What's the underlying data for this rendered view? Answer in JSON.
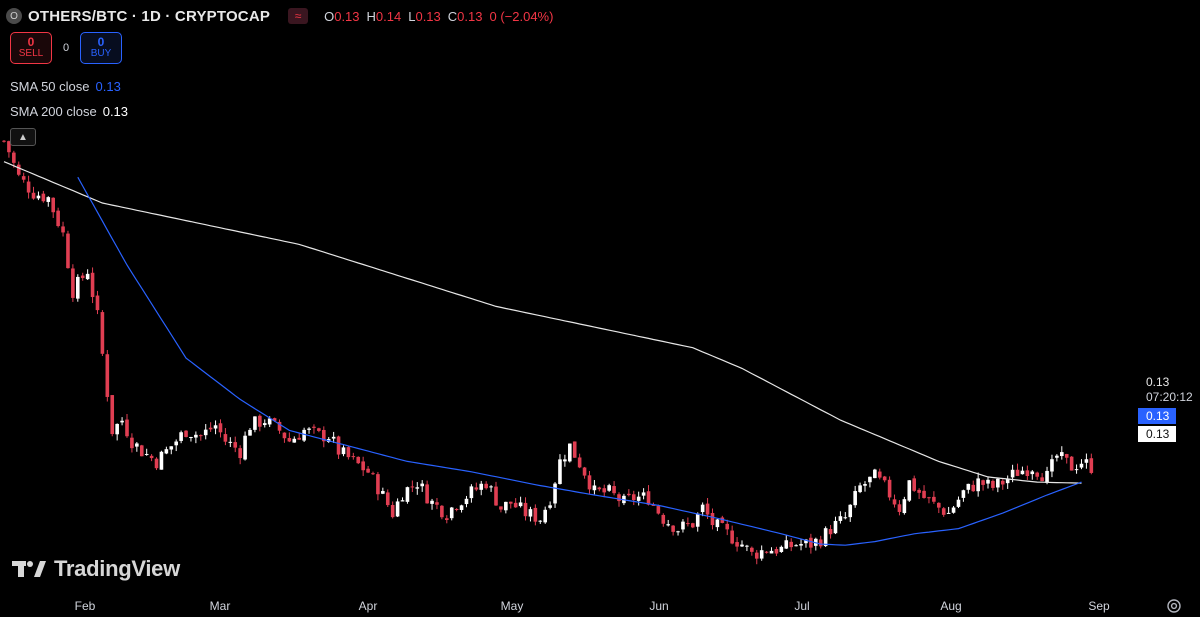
{
  "header": {
    "symbol_badge": "O",
    "title": "OTHERS/BTC · 1D · CRYPTOCAP",
    "indicator_icon": "≈",
    "ohlc": {
      "o_label": "O",
      "o": "0.13",
      "h_label": "H",
      "h": "0.14",
      "l_label": "L",
      "l": "0.13",
      "c_label": "C",
      "c": "0.13",
      "change": "0 (−2.04%)"
    }
  },
  "trade": {
    "sell_count": "0",
    "sell_label": "SELL",
    "spread": "0",
    "buy_count": "0",
    "buy_label": "BUY"
  },
  "indicators": {
    "sma50": {
      "label": "SMA 50 close",
      "value": "0.13"
    },
    "sma200": {
      "label": "SMA 200 close",
      "value": "0.13"
    }
  },
  "collapse_icon": "chevron-up-icon",
  "price_scale": {
    "last_price": "0.13",
    "countdown": "07:20:12",
    "sma50_value": "0.13",
    "sma200_value": "0.13"
  },
  "logo": {
    "text": "TradingView"
  },
  "colors": {
    "background": "#000000",
    "up_candle": "#ffffff",
    "down_candle": "#e03e52",
    "sma50": "#2962ff",
    "sma200": "#e6e6e6",
    "text": "#d1d4dc"
  },
  "chart_data": {
    "type": "candlestick",
    "title": "OTHERS/BTC · 1D · CRYPTOCAP",
    "x_ticks": [
      "Feb",
      "Mar",
      "Apr",
      "May",
      "Jun",
      "Jul",
      "Aug",
      "Sep"
    ],
    "y_range_approx": [
      0.1268,
      0.21
    ],
    "series": [
      {
        "name": "OTHERS/BTC daily close (approx.)",
        "type": "close",
        "points": [
          [
            0,
            0.204
          ],
          [
            1,
            0.202
          ],
          [
            3,
            0.197
          ],
          [
            6,
            0.194
          ],
          [
            9,
            0.193
          ],
          [
            12,
            0.186
          ],
          [
            14,
            0.175
          ],
          [
            17,
            0.179
          ],
          [
            19,
            0.17
          ],
          [
            22,
            0.148
          ],
          [
            24,
            0.15
          ],
          [
            26,
            0.146
          ],
          [
            28,
            0.144
          ],
          [
            31,
            0.142
          ],
          [
            34,
            0.145
          ],
          [
            37,
            0.148
          ],
          [
            40,
            0.147
          ],
          [
            43,
            0.149
          ],
          [
            45,
            0.146
          ],
          [
            48,
            0.144
          ],
          [
            50,
            0.149
          ],
          [
            53,
            0.15
          ],
          [
            56,
            0.148
          ],
          [
            58,
            0.146
          ],
          [
            61,
            0.148
          ],
          [
            64,
            0.147
          ],
          [
            66,
            0.147
          ],
          [
            68,
            0.144
          ],
          [
            71,
            0.142
          ],
          [
            74,
            0.14
          ],
          [
            76,
            0.137
          ],
          [
            79,
            0.132
          ],
          [
            81,
            0.136
          ],
          [
            84,
            0.138
          ],
          [
            87,
            0.134
          ],
          [
            90,
            0.132
          ],
          [
            92,
            0.134
          ],
          [
            95,
            0.136
          ],
          [
            98,
            0.138
          ],
          [
            101,
            0.133
          ],
          [
            103,
            0.134
          ],
          [
            106,
            0.132
          ],
          [
            109,
            0.131
          ],
          [
            111,
            0.135
          ],
          [
            113,
            0.142
          ],
          [
            115,
            0.145
          ],
          [
            118,
            0.14
          ],
          [
            120,
            0.136
          ],
          [
            123,
            0.136
          ],
          [
            126,
            0.134
          ],
          [
            128,
            0.135
          ],
          [
            131,
            0.135
          ],
          [
            134,
            0.131
          ],
          [
            137,
            0.129
          ],
          [
            140,
            0.13
          ],
          [
            142,
            0.133
          ],
          [
            144,
            0.13
          ],
          [
            147,
            0.128
          ],
          [
            150,
            0.126
          ],
          [
            152,
            0.124
          ],
          [
            155,
            0.125
          ],
          [
            158,
            0.125
          ],
          [
            161,
            0.126
          ],
          [
            164,
            0.126
          ],
          [
            166,
            0.127
          ],
          [
            168,
            0.129
          ],
          [
            171,
            0.131
          ],
          [
            174,
            0.137
          ],
          [
            177,
            0.139
          ],
          [
            179,
            0.137
          ],
          [
            182,
            0.133
          ],
          [
            184,
            0.138
          ],
          [
            187,
            0.135
          ],
          [
            190,
            0.133
          ],
          [
            192,
            0.132
          ],
          [
            195,
            0.136
          ],
          [
            198,
            0.138
          ],
          [
            201,
            0.137
          ],
          [
            203,
            0.138
          ],
          [
            206,
            0.14
          ],
          [
            209,
            0.141
          ],
          [
            212,
            0.139
          ],
          [
            214,
            0.143
          ],
          [
            217,
            0.141
          ],
          [
            219,
            0.142
          ],
          [
            221,
            0.141
          ]
        ]
      },
      {
        "name": "SMA 50 close",
        "type": "line",
        "points": [
          [
            15,
            0.197
          ],
          [
            25,
            0.18
          ],
          [
            37,
            0.162
          ],
          [
            48,
            0.154
          ],
          [
            58,
            0.148
          ],
          [
            70,
            0.145
          ],
          [
            82,
            0.142
          ],
          [
            95,
            0.14
          ],
          [
            108,
            0.1375
          ],
          [
            120,
            0.1355
          ],
          [
            133,
            0.1335
          ],
          [
            145,
            0.131
          ],
          [
            158,
            0.128
          ],
          [
            166,
            0.126
          ],
          [
            171,
            0.1258
          ],
          [
            177,
            0.1265
          ],
          [
            185,
            0.128
          ],
          [
            194,
            0.129
          ],
          [
            203,
            0.132
          ],
          [
            212,
            0.1355
          ],
          [
            219,
            0.138
          ]
        ]
      },
      {
        "name": "SMA 200 close",
        "type": "line",
        "points": [
          [
            0,
            0.2
          ],
          [
            20,
            0.192
          ],
          [
            40,
            0.188
          ],
          [
            60,
            0.184
          ],
          [
            80,
            0.178
          ],
          [
            100,
            0.172
          ],
          [
            120,
            0.168
          ],
          [
            140,
            0.164
          ],
          [
            150,
            0.16
          ],
          [
            160,
            0.155
          ],
          [
            170,
            0.15
          ],
          [
            180,
            0.146
          ],
          [
            190,
            0.142
          ],
          [
            200,
            0.139
          ],
          [
            210,
            0.138
          ],
          [
            219,
            0.1378
          ]
        ]
      }
    ]
  }
}
